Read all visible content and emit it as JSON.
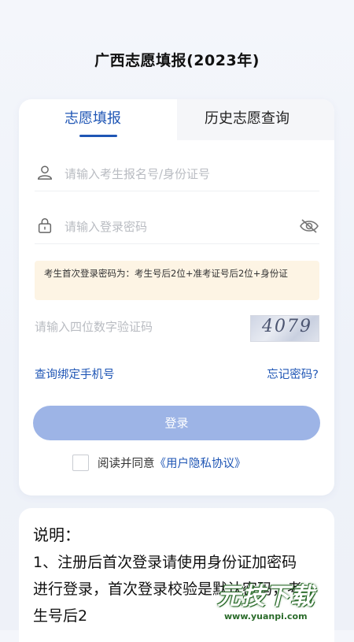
{
  "header": {
    "title": "广西志愿填报(2023年)"
  },
  "tabs": [
    {
      "label": "志愿填报",
      "active": true
    },
    {
      "label": "历史志愿查询",
      "active": false
    }
  ],
  "form": {
    "username_placeholder": "请输入考生报名号/身份证号",
    "password_placeholder": "请输入登录密码",
    "notice": "考生首次登录密码为：考生号后2位+准考证号后2位+身份证",
    "captcha_placeholder": "请输入四位数字验证码",
    "captcha_code": "4079",
    "bind_phone_link": "查询绑定手机号",
    "forgot_password_link": "忘记密码?",
    "login_button": "登录",
    "agree_text": "阅读并同意",
    "privacy_link": "《用户隐私协议》"
  },
  "description": {
    "title": "说明：",
    "text": "1、注册后首次登录请使用身份证加密码进行登录，首次登录校验是默认密码，考生号后2"
  },
  "watermark": {
    "brand": "元技下载",
    "url": "www.yuanpi.com"
  },
  "colors": {
    "accent": "#1f56b5",
    "button": "#9db4e6",
    "notice_bg": "#fdf4e4"
  }
}
